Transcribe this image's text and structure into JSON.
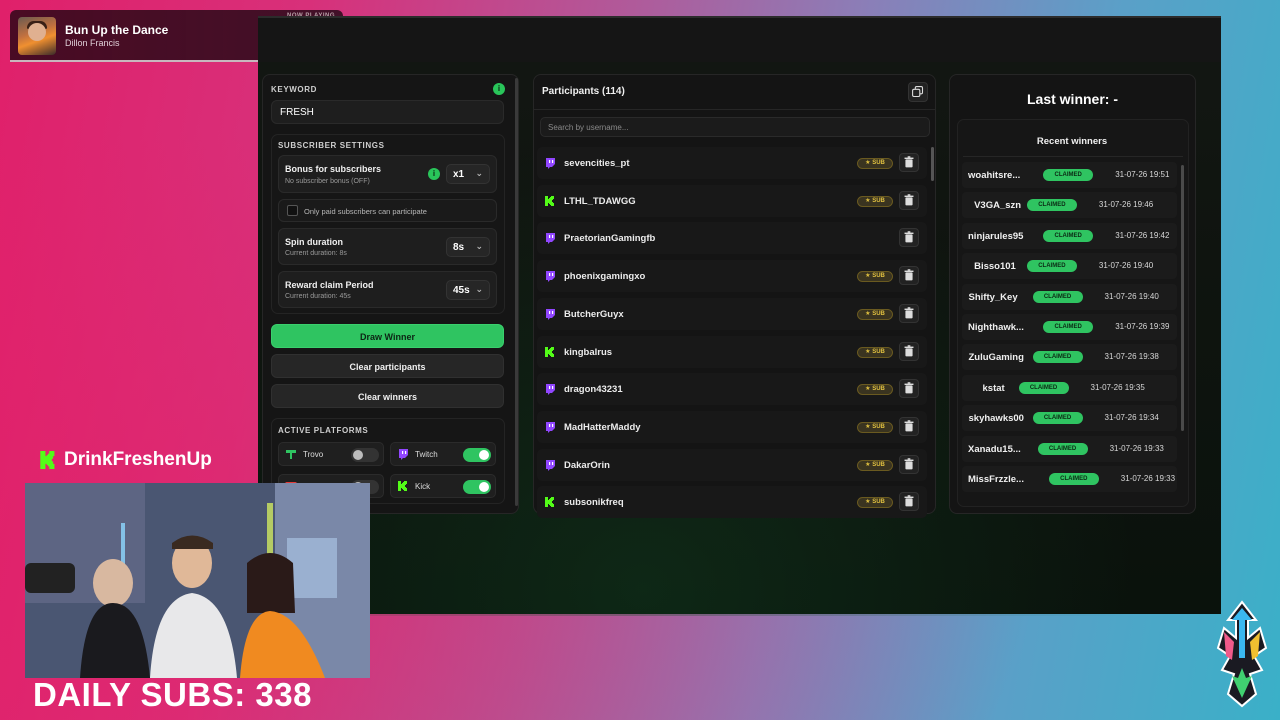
{
  "now_playing": {
    "label": "NOW PLAYING",
    "title": "Bun Up the Dance",
    "artist": "Dillon Francis"
  },
  "settings": {
    "keyword_label": "KEYWORD",
    "keyword_value": "FRESH",
    "subscriber_settings_label": "SUBSCRIBER SETTINGS",
    "bonus_title": "Bonus for subscribers",
    "bonus_sub": "No subscriber bonus (OFF)",
    "bonus_value": "x1",
    "paid_only_label": "Only paid subscribers can participate",
    "spin_title": "Spin duration",
    "spin_sub": "Current duration: 8s",
    "spin_value": "8s",
    "claim_title": "Reward claim Period",
    "claim_sub": "Current duration: 45s",
    "claim_value": "45s",
    "draw_button": "Draw Winner",
    "clear_participants_button": "Clear participants",
    "clear_winners_button": "Clear winners",
    "active_platforms_label": "ACTIVE PLATFORMS",
    "platforms": [
      {
        "name": "Trovo",
        "enabled": false,
        "color": "#2fc461"
      },
      {
        "name": "Twitch",
        "enabled": true,
        "color": "#9146ff"
      },
      {
        "name": "",
        "enabled": false,
        "color": "#e53935"
      },
      {
        "name": "Kick",
        "enabled": true,
        "color": "#53fc18"
      }
    ]
  },
  "participants": {
    "title": "Participants (114)",
    "search_placeholder": "Search by username...",
    "sub_badge": "SUB",
    "rows": [
      {
        "name": "sevencities_pt",
        "platform": "twitch",
        "sub": true
      },
      {
        "name": "LTHL_TDAWGG",
        "platform": "kick",
        "sub": true
      },
      {
        "name": "PraetorianGamingfb",
        "platform": "twitch",
        "sub": false
      },
      {
        "name": "phoenixgamingxo",
        "platform": "twitch",
        "sub": true
      },
      {
        "name": "ButcherGuyx",
        "platform": "twitch",
        "sub": true
      },
      {
        "name": "kingbalrus",
        "platform": "kick",
        "sub": true
      },
      {
        "name": "dragon43231",
        "platform": "twitch",
        "sub": true
      },
      {
        "name": "MadHatterMaddy",
        "platform": "twitch",
        "sub": true
      },
      {
        "name": "DakarOrin",
        "platform": "twitch",
        "sub": true
      },
      {
        "name": "subsonikfreq",
        "platform": "kick",
        "sub": true
      }
    ]
  },
  "winners": {
    "last_winner": "Last winner: -",
    "recent_title": "Recent winners",
    "claimed_label": "CLAIMED",
    "rows": [
      {
        "name": "woahitsre...",
        "date": "31-07-26 19:51"
      },
      {
        "name": "V3GA_szn",
        "date": "31-07-26 19:46"
      },
      {
        "name": "ninjarules95",
        "date": "31-07-26 19:42"
      },
      {
        "name": "Bisso101",
        "date": "31-07-26 19:40"
      },
      {
        "name": "Shifty_Key",
        "date": "31-07-26 19:40"
      },
      {
        "name": "Nighthawk...",
        "date": "31-07-26 19:39"
      },
      {
        "name": "ZuluGaming",
        "date": "31-07-26 19:38"
      },
      {
        "name": "kstat",
        "date": "31-07-26 19:35"
      },
      {
        "name": "skyhawks00",
        "date": "31-07-26 19:34"
      },
      {
        "name": "Xanadu15...",
        "date": "31-07-26 19:33"
      },
      {
        "name": "MissFrzzle...",
        "date": "31-07-26 19:33"
      }
    ]
  },
  "overlay": {
    "channel_name": "DrinkFreshenUp",
    "daily_subs": "DAILY SUBS: 338"
  },
  "colors": {
    "accent_green": "#2fc461",
    "twitch": "#9146ff",
    "kick": "#53fc18"
  }
}
